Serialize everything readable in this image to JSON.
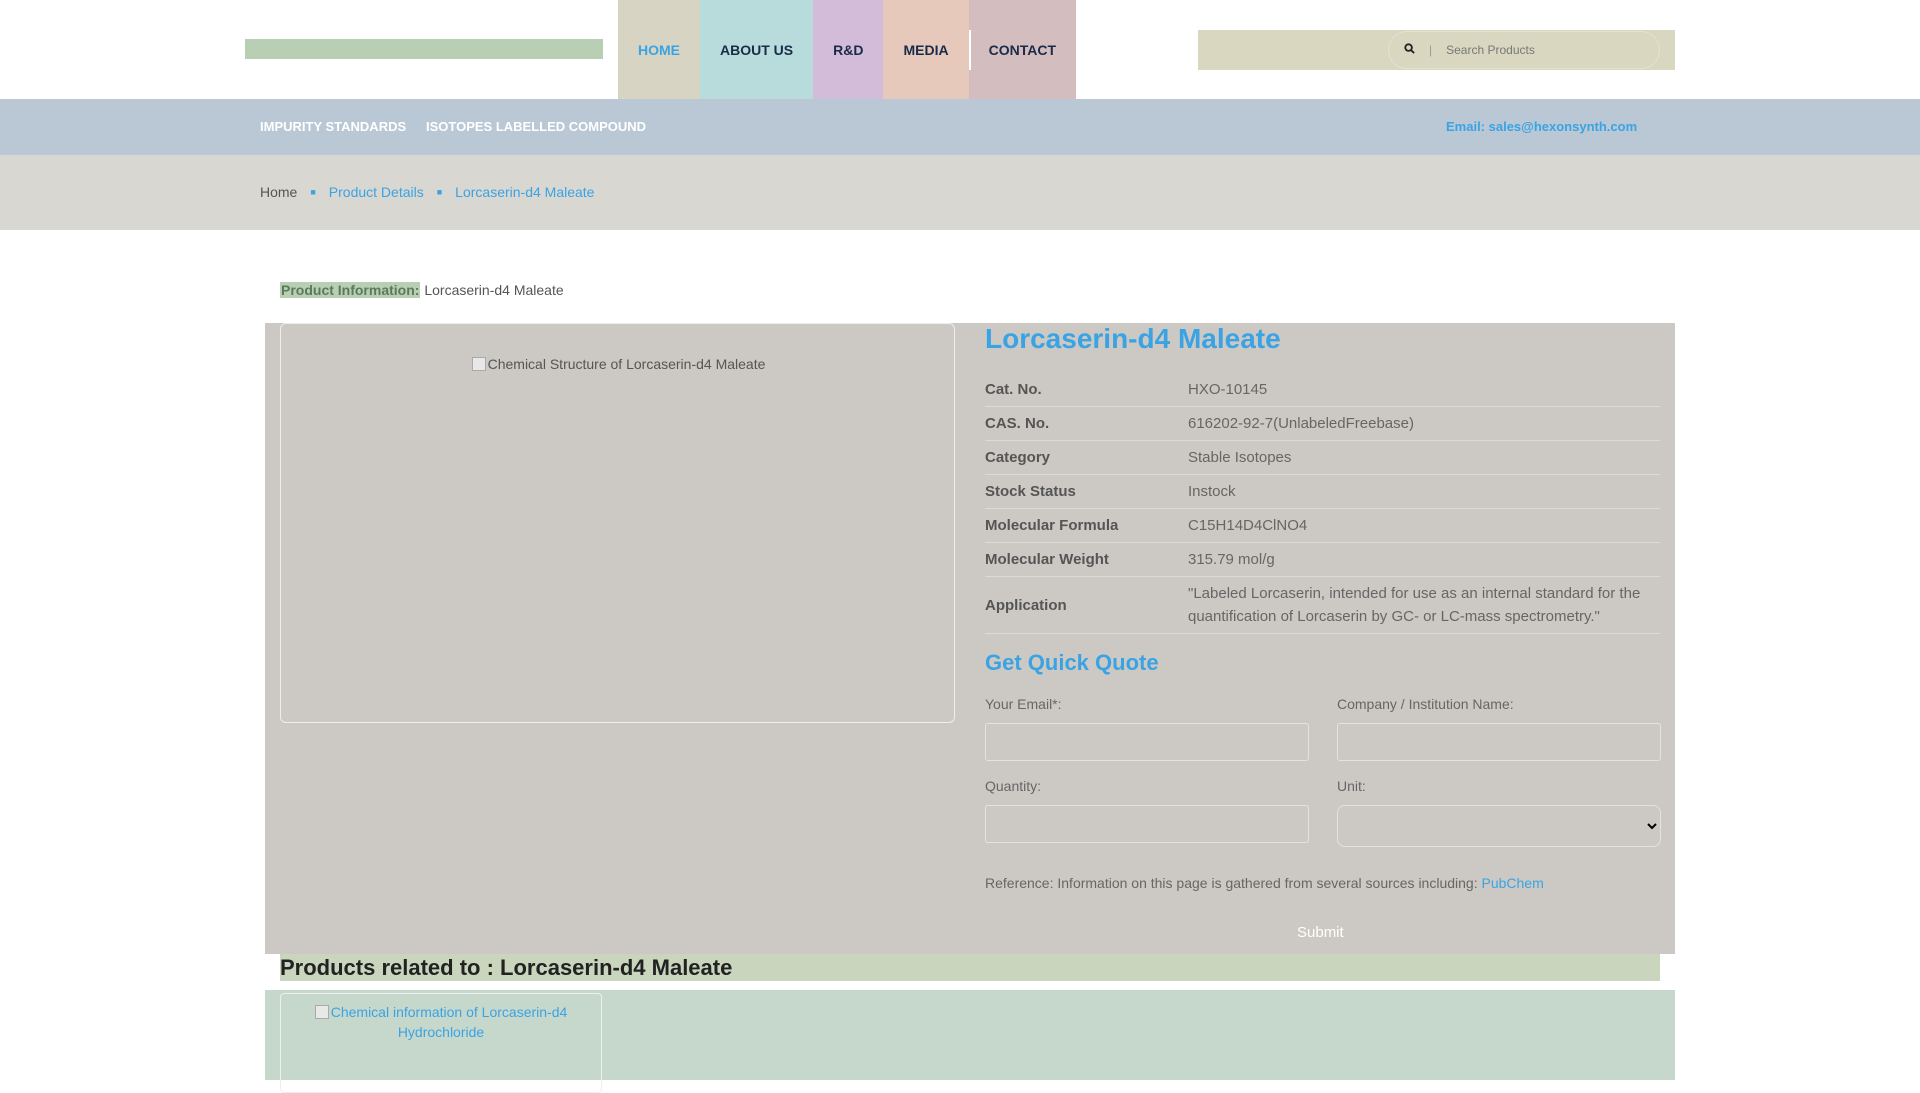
{
  "header": {
    "nav": [
      {
        "label": "HOME"
      },
      {
        "label": "ABOUT US"
      },
      {
        "label": "R&D"
      },
      {
        "label": "MEDIA"
      },
      {
        "label": "CONTACT"
      }
    ],
    "search": {
      "placeholder": "Search Products",
      "separator": "|",
      "icon": "search-icon"
    }
  },
  "subnav": {
    "links": [
      "IMPURITY STANDARDS",
      "ISOTOPES LABELLED COMPOUND"
    ],
    "email": "Email: sales@hexonsynth.com"
  },
  "breadcrumb": {
    "home": "Home",
    "product_details": "Product Details",
    "current": "Lorcaserin-d4 Maleate"
  },
  "product_info": {
    "label": "Product Information:",
    "name": "Lorcaserin-d4 Maleate"
  },
  "product": {
    "image_alt": "Chemical Structure of Lorcaserin-d4 Maleate",
    "title": "Lorcaserin-d4 Maleate",
    "specs": [
      {
        "key": "Cat. No.",
        "value": "HXO-10145"
      },
      {
        "key": "CAS. No.",
        "value": "616202-92-7(UnlabeledFreebase)"
      },
      {
        "key": "Category",
        "value": "Stable Isotopes"
      },
      {
        "key": "Stock Status",
        "value": "Instock"
      },
      {
        "key": "Molecular Formula",
        "value": "C15H14D4ClNO4"
      },
      {
        "key": "Molecular Weight",
        "value": "315.79 mol/g"
      },
      {
        "key": "Application",
        "value": "\"Labeled Lorcaserin, intended for use as an internal standard for the quantification of Lorcaserin by GC- or LC-mass spectrometry.\""
      }
    ]
  },
  "quote": {
    "title": "Get Quick Quote",
    "email_label": "Your Email*:",
    "company_label": "Company / Institution Name:",
    "quantity_label": "Quantity:",
    "unit_label": "Unit:",
    "unit_value": "",
    "reference_text": "Reference: Information on this page is gathered from several sources including:",
    "reference_link": "PubChem",
    "submit_label": "Submit"
  },
  "related": {
    "heading": "Products related to : Lorcaserin-d4 Maleate",
    "items": [
      {
        "alt": "Chemical information of Lorcaserin-d4 Hydrochloride"
      }
    ]
  },
  "colors": {
    "accent": "#3aa3e3",
    "nav_home": "#d8d4c3",
    "nav_about": "#b7dcdb",
    "nav_rd": "#d3bcd9",
    "nav_media": "#e6c9bb",
    "nav_contact": "#d4bdbf",
    "subnav": "#bac8d6",
    "breadcrumb_bar": "#d9d7d1",
    "main_panel": "#ccc9c4",
    "related_panel": "#c6d8cc"
  }
}
